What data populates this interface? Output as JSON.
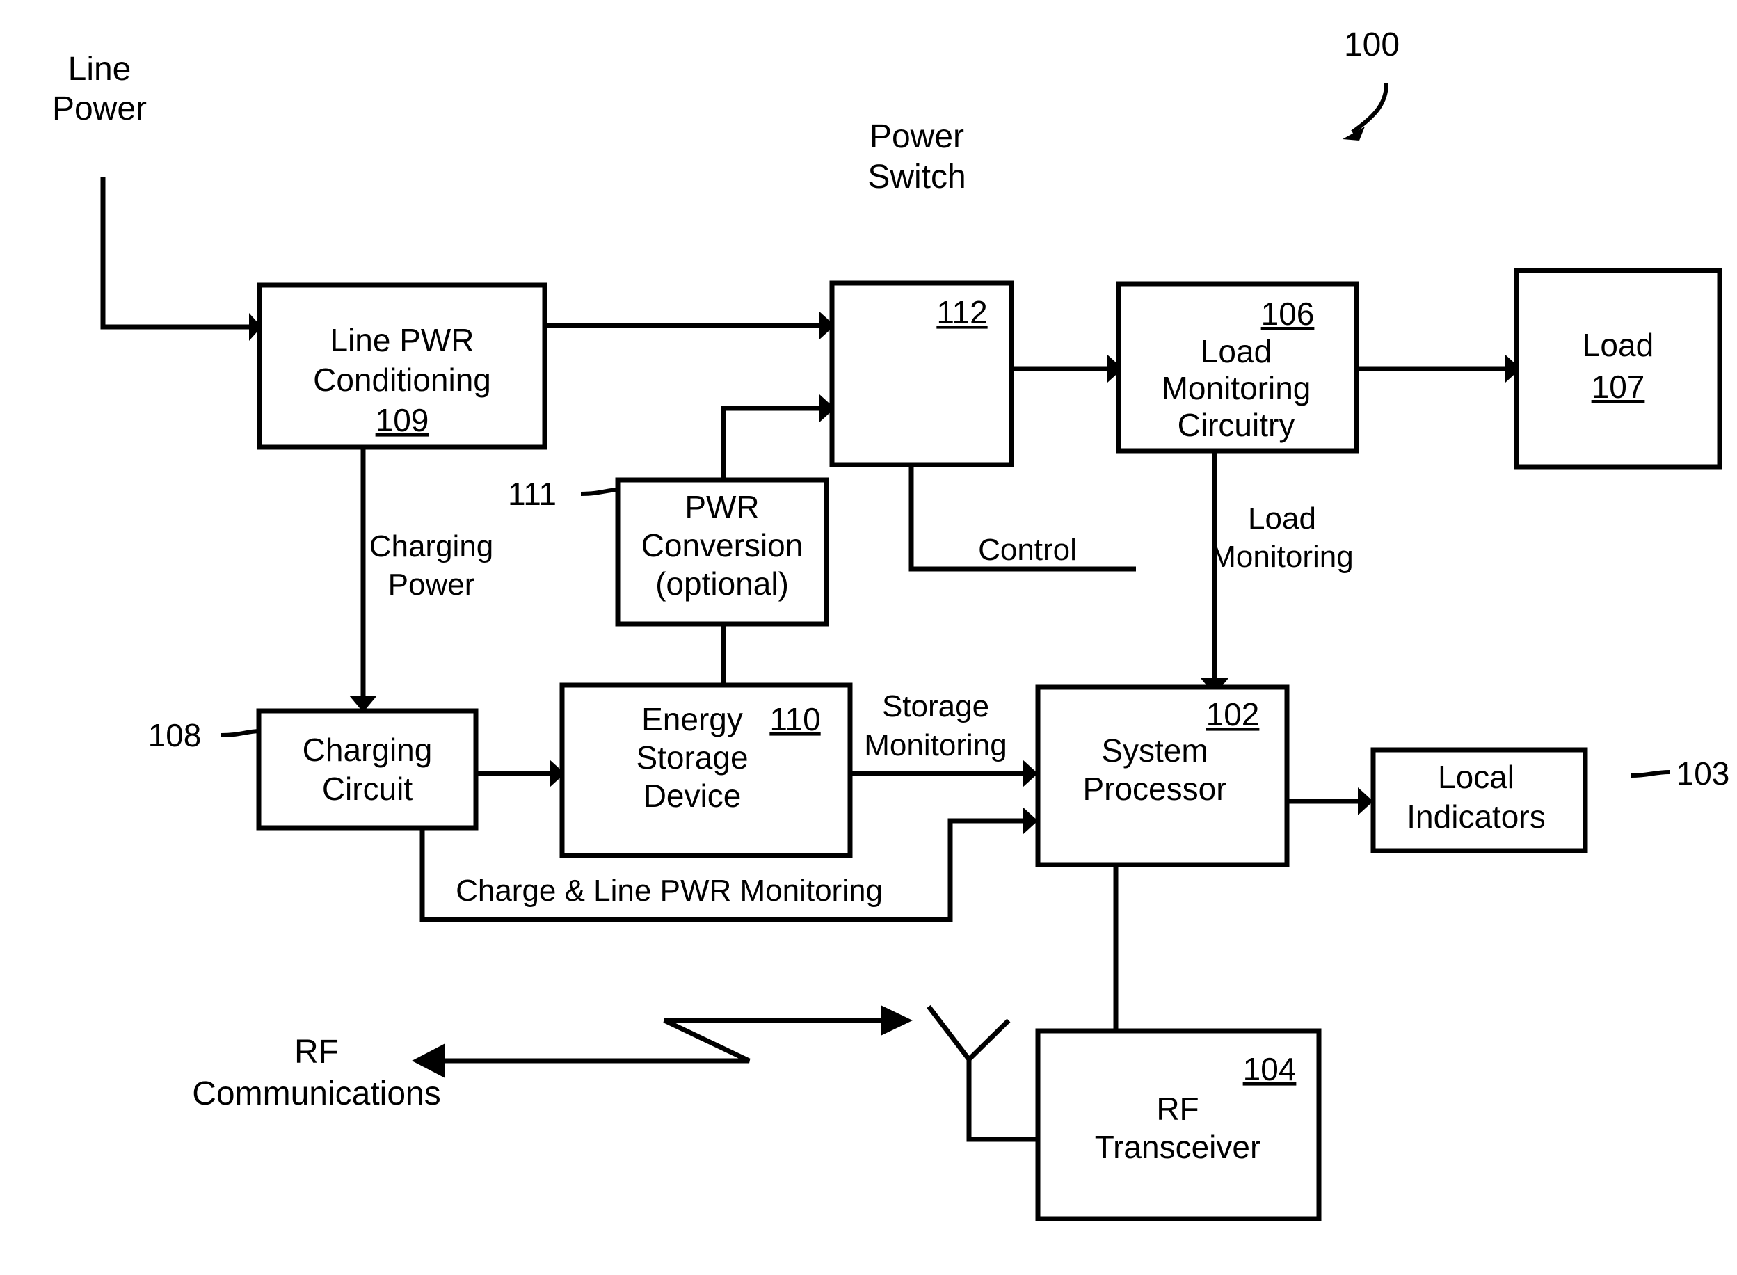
{
  "figure": {
    "system_ref": "100",
    "colors": {
      "ink": "#000000",
      "paper": "#ffffff"
    }
  },
  "blocks": {
    "line_pwr_conditioning": {
      "line1": "Line PWR",
      "line2": "Conditioning",
      "ref": "109"
    },
    "power_switch": {
      "title_line1": "Power",
      "title_line2": "Switch",
      "ref": "112"
    },
    "load_monitoring": {
      "line1": "Load",
      "line2": "Monitoring",
      "line3": "Circuitry",
      "ref": "106"
    },
    "load": {
      "line1": "Load",
      "ref": "107"
    },
    "pwr_conversion": {
      "line1": "PWR",
      "line2": "Conversion",
      "line3": "(optional)",
      "ref": "111"
    },
    "charging_circuit": {
      "line1": "Charging",
      "line2": "Circuit",
      "ref": "108"
    },
    "energy_storage": {
      "line1": "Energy",
      "line2": "Storage",
      "line3": "Device",
      "ref": "110"
    },
    "system_processor": {
      "line1": "System",
      "line2": "Processor",
      "ref": "102"
    },
    "local_indicators": {
      "line1": "Local",
      "line2": "Indicators",
      "ref": "103"
    },
    "rf_transceiver": {
      "line1": "RF",
      "line2": "Transceiver",
      "ref": "104"
    }
  },
  "labels": {
    "line_power_l1": "Line",
    "line_power_l2": "Power",
    "charging_power_l1": "Charging",
    "charging_power_l2": "Power",
    "control": "Control",
    "load_monitoring_l1": "Load",
    "load_monitoring_l2": "Monitoring",
    "storage_monitoring_l1": "Storage",
    "storage_monitoring_l2": "Monitoring",
    "charge_line_pwr_monitoring": "Charge & Line PWR Monitoring",
    "rf_communications_l1": "RF",
    "rf_communications_l2": "Communications"
  }
}
